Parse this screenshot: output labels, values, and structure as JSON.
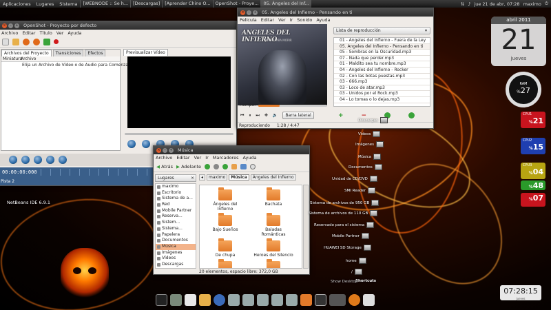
{
  "top_panel": {
    "menus": [
      "Aplicaciones",
      "Lugares",
      "Sistema"
    ],
    "tasks": [
      "[WEBNODE :: Se h...",
      "[Descargas]",
      "[Aprender Chino O...",
      "OpenShot - Proye...",
      "05. Ángeles del Inf..."
    ],
    "datetime": "jue 21 de abr, 07:28",
    "user": "maximo"
  },
  "openshot": {
    "title": "OpenShot - Proyecto por defecto",
    "menus": [
      "Archivo",
      "Editar",
      "Título",
      "Ver",
      "Ayuda"
    ],
    "tabs": [
      "Archivos del Proyecto",
      "Transiciones",
      "Efectos"
    ],
    "columns": [
      "Miniatura",
      "Archivo"
    ],
    "hint": "Elija un Archivo de Vídeo o de Audio para Comenzar",
    "preview_tab": "Previsualizar Vídeo",
    "timecode": "00:00:00:000",
    "track": "Pista 2"
  },
  "music": {
    "title": "05. Angeles del Infierno - Pensando en ti",
    "menus": [
      "Película",
      "Editar",
      "Ver",
      "Ir",
      "Sonido",
      "Ayuda"
    ],
    "album_logo": "ANGELES DEL INFIERNO",
    "album_sub": "JOVEN PARA MORIR",
    "playlist_label": "Lista de reproducción",
    "playlist": [
      "01 - Ángeles del Infierno - Fuera de la Ley",
      "05. Ángeles del Infierno - Pensando en ti",
      "05 - Sombras en la Oscuridad.mp3",
      "07 - Nada que perder.mp3",
      "01 - Maldito sea tu nombre.mp3",
      "04 - Ángeles del Infierno - Rocker",
      "02 - Con las botas puestas.mp3",
      "03 - 666.mp3",
      "03 - Loco de atar.mp3",
      "03 - Unidos por el Rock.mp3",
      "04 - Lo tomas o lo dejas.mp3"
    ],
    "selected_index": 1,
    "time_label": "Tiempo:",
    "sidebar_button": "Barra lateral",
    "status": "Reproduciendo",
    "position": "1:28 / 4:47",
    "progress": 0.31
  },
  "nautilus": {
    "title": "Música",
    "menus": [
      "Archivo",
      "Editar",
      "Ver",
      "Ir",
      "Marcadores",
      "Ayuda"
    ],
    "back": "Atrás",
    "forward": "Adelante",
    "places_label": "Lugares",
    "places": [
      "maximo",
      "Escritorio",
      "Sistema de a...",
      "Red",
      "Mobile Partner",
      "Reserva...",
      "Sistem...",
      "Sistema...",
      "Papelera",
      "Documentos",
      "Música",
      "Imágenes",
      "Vídeos",
      "Descargas"
    ],
    "selected_place": 10,
    "breadcrumb": [
      "maximo",
      "Música",
      "Ángeles del Infierno"
    ],
    "folders": [
      "Ángeles del Infierno",
      "Bachata",
      "Bajo Sueños",
      "Baladas Románticas",
      "De chupa",
      "Heroes del Silencio",
      "",
      ""
    ],
    "status": "20 elementos, espacio libre: 372,0 GB"
  },
  "desktop": {
    "netbeans": "NetBeans IDE 6.9.1",
    "icons": [
      "Descargas",
      "Vídeos",
      "Imágenes",
      "Música",
      "Documentos",
      "Unidad de CD/DVD",
      "SMI Reader",
      "Sistema de archivos de 950 GB",
      "Sistema de archivos de 110 GB",
      "Reservado para el sistema",
      "Mobile Partner",
      "HUAWEI SD Storage",
      "home",
      "/",
      "Shortcuts",
      "Show Desktop"
    ]
  },
  "widgets": {
    "month": "abril 2011",
    "day": "21",
    "weekday": "jueves",
    "ram_label": "RAM",
    "ram_value": "27",
    "cpus": [
      {
        "label": "CPU1",
        "value": "21",
        "color": "#c8141e"
      },
      {
        "label": "CPU2",
        "value": "15",
        "color": "#1f3fb0"
      },
      {
        "label": "CPU3",
        "value": "04",
        "color": "#b8a412"
      },
      {
        "label": "CPU4",
        "value": "48",
        "color": "#2a9a2a"
      },
      {
        "label": "",
        "value": "07",
        "color": "#c8141e"
      }
    ],
    "time": "07:28:15",
    "time_sub": "jueves"
  },
  "colors": {
    "accent": "#e27a2a",
    "selection": "#f3b38a",
    "panel": "#2e2e2e"
  }
}
